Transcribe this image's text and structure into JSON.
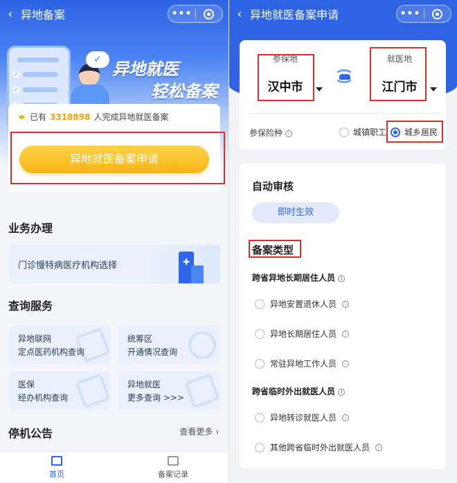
{
  "left": {
    "nav": {
      "title": "异地备案",
      "back_glyph": "‹",
      "more_glyph": "•••"
    },
    "hero": {
      "slogan_line1": "异地就医",
      "slogan_line2": "轻松备案",
      "check_glyph": "✓"
    },
    "notice": {
      "prefix": "已有",
      "count": "3318898",
      "suffix": "人完成异地就医备案"
    },
    "apply_button": "异地就医备案申请",
    "business": {
      "title": "业务办理",
      "card_label": "门诊慢特病医疗机构选择"
    },
    "query": {
      "title": "查询服务",
      "cards": [
        {
          "line1": "异地联网",
          "line2": "定点医药机构查询"
        },
        {
          "line1": "统筹区",
          "line2": "开通情况查询"
        },
        {
          "line1": "医保",
          "line2": "经办机构查询"
        },
        {
          "line1": "异地就医",
          "line2": "更多查询 >>>"
        }
      ]
    },
    "notice_section": {
      "title": "停机公告",
      "more": "查看更多 ›"
    },
    "tabbar": {
      "home": "首页",
      "records": "备案记录"
    }
  },
  "right": {
    "nav": {
      "title": "异地就医备案申请",
      "back_glyph": "‹",
      "more_glyph": "•••"
    },
    "insured_place": {
      "label": "参保地",
      "city": "汉中市"
    },
    "medical_place": {
      "label": "就医地",
      "city": "江门市"
    },
    "insurance_type": {
      "label": "参保险种",
      "options": [
        "城镇职工",
        "城乡居民"
      ],
      "selected": "城乡居民"
    },
    "review": {
      "title": "自动审核",
      "pill": "即时生效"
    },
    "filing_type": {
      "title": "备案类型"
    },
    "group1": {
      "title": "跨省异地长期居住人员",
      "options": [
        "异地安置退休人员",
        "异地长期居住人员",
        "常驻异地工作人员"
      ]
    },
    "group2": {
      "title": "跨省临时外出就医人员",
      "options": [
        "异地转诊就医人员",
        "其他跨省临时外出就医人员"
      ]
    }
  },
  "colors": {
    "primary": "#2f66e8",
    "header": "#2e63e4",
    "apply_button": "#f6b414",
    "count": "#f0a400",
    "highlight_box": "#e02b2b"
  }
}
